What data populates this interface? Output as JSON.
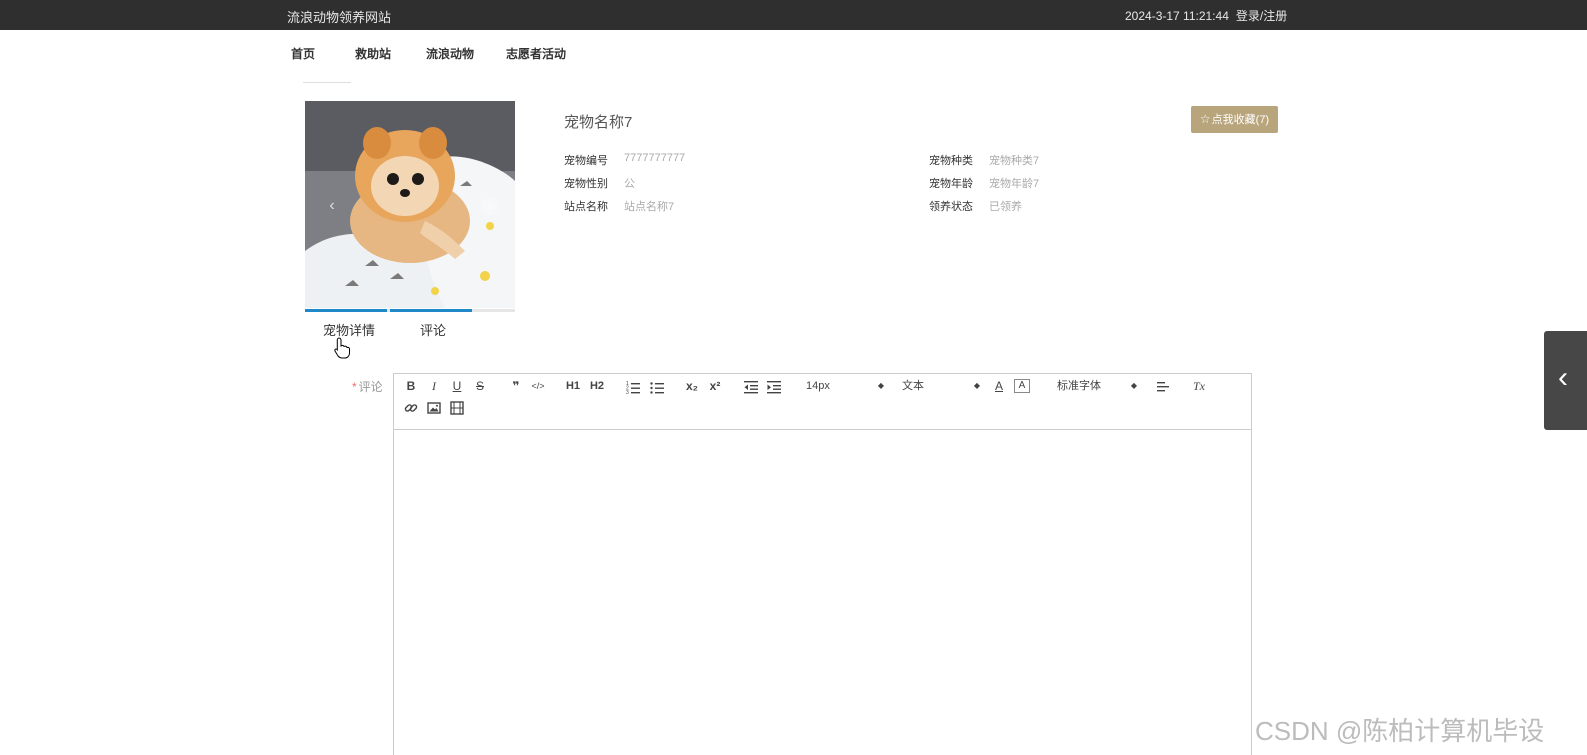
{
  "header": {
    "site_title": "流浪动物领养网站",
    "datetime": "2024-3-17 11:21:44",
    "login_label": "登录/注册"
  },
  "nav": {
    "items": [
      {
        "label": "首页"
      },
      {
        "label": "救助站"
      },
      {
        "label": "流浪动物"
      },
      {
        "label": "志愿者活动"
      }
    ]
  },
  "carousel": {
    "prev_glyph": "‹",
    "next_glyph": "›",
    "active_index": 0,
    "slide_count": 2,
    "indicator_color": "#1e88c8"
  },
  "pet": {
    "name": "宠物名称7",
    "favorite_label": "点我收藏(7)",
    "favorite_icon": "star-outline-icon",
    "fields": [
      {
        "label": "宠物编号",
        "value": "7777777777"
      },
      {
        "label": "宠物种类",
        "value": "宠物种类7"
      },
      {
        "label": "宠物性别",
        "value": "公"
      },
      {
        "label": "宠物年龄",
        "value": "宠物年龄7"
      },
      {
        "label": "站点名称",
        "value": "站点名称7"
      },
      {
        "label": "领养状态",
        "value": "已领养"
      }
    ]
  },
  "tabs": [
    {
      "label": "宠物详情",
      "active": true
    },
    {
      "label": "评论",
      "active": false
    }
  ],
  "comment": {
    "required_mark": "*",
    "label": "评论",
    "editor_value": ""
  },
  "editor_toolbar": {
    "font_size": "14px",
    "header_select": "文本",
    "font_family": "标准字体",
    "buttons": {
      "bold": "B",
      "italic": "I",
      "underline": "U",
      "strike": "S",
      "quote": "❞",
      "code": "</>",
      "h1": "H1",
      "h2": "H2",
      "subscript": "x₂",
      "superscript": "x²",
      "color": "A",
      "background": "A",
      "clean": "Tx"
    }
  },
  "side_toggle_glyph": "‹",
  "watermark": "CSDN @陈柏计算机毕设",
  "colors": {
    "topbar": "#2f2f2f",
    "favorite_button": "#b8a57c",
    "side_toggle": "#474747",
    "required": "#f56c6c"
  }
}
